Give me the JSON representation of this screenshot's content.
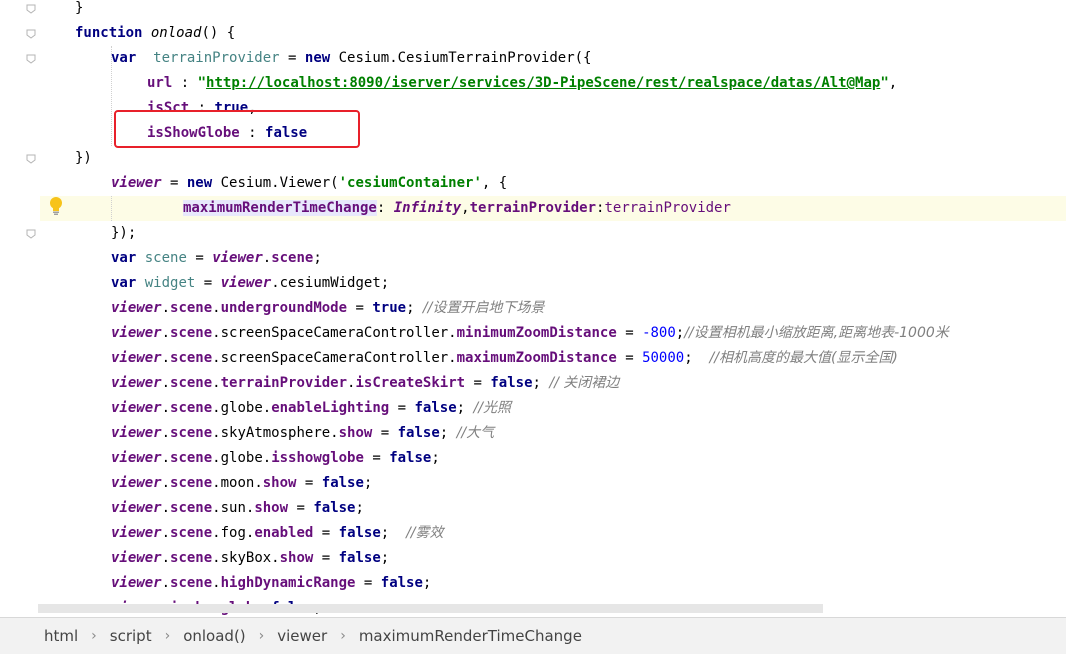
{
  "editor": {
    "lines": [
      {
        "tokens": [
          {
            "t": "}",
            "c": "plain"
          }
        ]
      },
      {
        "tokens": [
          {
            "t": "function",
            "c": "kw"
          },
          {
            "t": " ",
            "c": "plain"
          },
          {
            "t": "onload",
            "c": "fn"
          },
          {
            "t": "() {",
            "c": "plain"
          }
        ]
      },
      {
        "tokens": [
          {
            "t": "var",
            "c": "kw"
          },
          {
            "t": "  ",
            "c": "plain"
          },
          {
            "t": "terrainProvider",
            "c": "lv"
          },
          {
            "t": " = ",
            "c": "plain"
          },
          {
            "t": "new",
            "c": "kw"
          },
          {
            "t": " Cesium.CesiumTerrainProvider({",
            "c": "plain"
          }
        ]
      },
      {
        "tokens": [
          {
            "t": "url",
            "c": "pr"
          },
          {
            "t": " : ",
            "c": "plain"
          },
          {
            "t": "\"",
            "c": "str"
          },
          {
            "t": "http://localhost:8090/iserver/services/3D-PipeScene/rest/realspace/datas/Alt@Map",
            "c": "strlink"
          },
          {
            "t": "\"",
            "c": "str"
          },
          {
            "t": ",",
            "c": "plain"
          }
        ]
      },
      {
        "tokens": [
          {
            "t": "isSct",
            "c": "pr"
          },
          {
            "t": " : ",
            "c": "plain"
          },
          {
            "t": "true",
            "c": "kw"
          },
          {
            "t": ",",
            "c": "plain"
          }
        ]
      },
      {
        "tokens": [
          {
            "t": "isShowGlobe",
            "c": "pr"
          },
          {
            "t": " : ",
            "c": "plain"
          },
          {
            "t": "false",
            "c": "kw"
          }
        ]
      },
      {
        "tokens": [
          {
            "t": "})",
            "c": "plain"
          }
        ]
      },
      {
        "tokens": [
          {
            "t": "viewer",
            "c": "gv"
          },
          {
            "t": " = ",
            "c": "plain"
          },
          {
            "t": "new",
            "c": "kw"
          },
          {
            "t": " Cesium.Viewer(",
            "c": "plain"
          },
          {
            "t": "'cesiumContainer'",
            "c": "str"
          },
          {
            "t": ", {",
            "c": "plain"
          }
        ]
      },
      {
        "tokens": [
          {
            "t": "maximumRenderTimeChange",
            "c": "pr hl"
          },
          {
            "t": ": ",
            "c": "plain"
          },
          {
            "t": "Infinity",
            "c": "gv"
          },
          {
            "t": ",",
            "c": "plain"
          },
          {
            "t": "terrainProvider",
            "c": "pr"
          },
          {
            "t": ":",
            "c": "plain"
          },
          {
            "t": "terrainProvider",
            "c": "pr2"
          }
        ]
      },
      {
        "tokens": [
          {
            "t": "});",
            "c": "plain"
          }
        ]
      },
      {
        "tokens": [
          {
            "t": "var",
            "c": "kw"
          },
          {
            "t": " ",
            "c": "plain"
          },
          {
            "t": "scene",
            "c": "lv"
          },
          {
            "t": " = ",
            "c": "plain"
          },
          {
            "t": "viewer",
            "c": "gv"
          },
          {
            "t": ".",
            "c": "plain"
          },
          {
            "t": "scene",
            "c": "pr"
          },
          {
            "t": ";",
            "c": "plain"
          }
        ]
      },
      {
        "tokens": [
          {
            "t": "var",
            "c": "kw"
          },
          {
            "t": " ",
            "c": "plain"
          },
          {
            "t": "widget",
            "c": "lv"
          },
          {
            "t": " = ",
            "c": "plain"
          },
          {
            "t": "viewer",
            "c": "gv"
          },
          {
            "t": ".cesiumWidget;",
            "c": "plain"
          }
        ]
      },
      {
        "tokens": [
          {
            "t": "viewer",
            "c": "gv"
          },
          {
            "t": ".",
            "c": "plain"
          },
          {
            "t": "scene",
            "c": "pr"
          },
          {
            "t": ".",
            "c": "plain"
          },
          {
            "t": "undergroundMode",
            "c": "pr"
          },
          {
            "t": " = ",
            "c": "plain"
          },
          {
            "t": "true",
            "c": "kw"
          },
          {
            "t": "; ",
            "c": "plain"
          },
          {
            "t": "//设置开启地下场景",
            "c": "cm"
          }
        ]
      },
      {
        "tokens": [
          {
            "t": "viewer",
            "c": "gv"
          },
          {
            "t": ".",
            "c": "plain"
          },
          {
            "t": "scene",
            "c": "pr"
          },
          {
            "t": ".screenSpaceCameraController.",
            "c": "plain"
          },
          {
            "t": "minimumZoomDistance",
            "c": "pr"
          },
          {
            "t": " = ",
            "c": "plain"
          },
          {
            "t": "-800",
            "c": "num"
          },
          {
            "t": ";",
            "c": "plain"
          },
          {
            "t": "//设置相机最小缩放距离,距离地表-1000米",
            "c": "cm"
          }
        ]
      },
      {
        "tokens": [
          {
            "t": "viewer",
            "c": "gv"
          },
          {
            "t": ".",
            "c": "plain"
          },
          {
            "t": "scene",
            "c": "pr"
          },
          {
            "t": ".screenSpaceCameraController.",
            "c": "plain"
          },
          {
            "t": "maximumZoomDistance",
            "c": "pr"
          },
          {
            "t": " = ",
            "c": "plain"
          },
          {
            "t": "50000",
            "c": "num"
          },
          {
            "t": ";  ",
            "c": "plain"
          },
          {
            "t": "//相机高度的最大值(显示全国)",
            "c": "cm"
          }
        ]
      },
      {
        "tokens": [
          {
            "t": "viewer",
            "c": "gv"
          },
          {
            "t": ".",
            "c": "plain"
          },
          {
            "t": "scene",
            "c": "pr"
          },
          {
            "t": ".",
            "c": "plain"
          },
          {
            "t": "terrainProvider",
            "c": "pr"
          },
          {
            "t": ".",
            "c": "plain"
          },
          {
            "t": "isCreateSkirt",
            "c": "pr"
          },
          {
            "t": " = ",
            "c": "plain"
          },
          {
            "t": "false",
            "c": "kw"
          },
          {
            "t": "; ",
            "c": "plain"
          },
          {
            "t": "// 关闭裙边",
            "c": "cm"
          }
        ]
      },
      {
        "tokens": [
          {
            "t": "viewer",
            "c": "gv"
          },
          {
            "t": ".",
            "c": "plain"
          },
          {
            "t": "scene",
            "c": "pr"
          },
          {
            "t": ".globe.",
            "c": "plain"
          },
          {
            "t": "enableLighting",
            "c": "pr"
          },
          {
            "t": " = ",
            "c": "plain"
          },
          {
            "t": "false",
            "c": "kw"
          },
          {
            "t": "; ",
            "c": "plain"
          },
          {
            "t": "//光照",
            "c": "cm"
          }
        ]
      },
      {
        "tokens": [
          {
            "t": "viewer",
            "c": "gv"
          },
          {
            "t": ".",
            "c": "plain"
          },
          {
            "t": "scene",
            "c": "pr"
          },
          {
            "t": ".skyAtmosphere.",
            "c": "plain"
          },
          {
            "t": "show",
            "c": "pr"
          },
          {
            "t": " = ",
            "c": "plain"
          },
          {
            "t": "false",
            "c": "kw"
          },
          {
            "t": "; ",
            "c": "plain"
          },
          {
            "t": "//大气",
            "c": "cm"
          }
        ]
      },
      {
        "tokens": [
          {
            "t": "viewer",
            "c": "gv"
          },
          {
            "t": ".",
            "c": "plain"
          },
          {
            "t": "scene",
            "c": "pr"
          },
          {
            "t": ".globe.",
            "c": "plain"
          },
          {
            "t": "isshowglobe",
            "c": "pr"
          },
          {
            "t": " = ",
            "c": "plain"
          },
          {
            "t": "false",
            "c": "kw"
          },
          {
            "t": ";",
            "c": "plain"
          }
        ]
      },
      {
        "tokens": [
          {
            "t": "viewer",
            "c": "gv"
          },
          {
            "t": ".",
            "c": "plain"
          },
          {
            "t": "scene",
            "c": "pr"
          },
          {
            "t": ".moon.",
            "c": "plain"
          },
          {
            "t": "show",
            "c": "pr"
          },
          {
            "t": " = ",
            "c": "plain"
          },
          {
            "t": "false",
            "c": "kw"
          },
          {
            "t": ";",
            "c": "plain"
          }
        ]
      },
      {
        "tokens": [
          {
            "t": "viewer",
            "c": "gv"
          },
          {
            "t": ".",
            "c": "plain"
          },
          {
            "t": "scene",
            "c": "pr"
          },
          {
            "t": ".sun.",
            "c": "plain"
          },
          {
            "t": "show",
            "c": "pr"
          },
          {
            "t": " = ",
            "c": "plain"
          },
          {
            "t": "false",
            "c": "kw"
          },
          {
            "t": ";",
            "c": "plain"
          }
        ]
      },
      {
        "tokens": [
          {
            "t": "viewer",
            "c": "gv"
          },
          {
            "t": ".",
            "c": "plain"
          },
          {
            "t": "scene",
            "c": "pr"
          },
          {
            "t": ".fog.",
            "c": "plain"
          },
          {
            "t": "enabled",
            "c": "pr"
          },
          {
            "t": " = ",
            "c": "plain"
          },
          {
            "t": "false",
            "c": "kw"
          },
          {
            "t": ";  ",
            "c": "plain"
          },
          {
            "t": "//雾效",
            "c": "cm"
          }
        ]
      },
      {
        "tokens": [
          {
            "t": "viewer",
            "c": "gv"
          },
          {
            "t": ".",
            "c": "plain"
          },
          {
            "t": "scene",
            "c": "pr"
          },
          {
            "t": ".skyBox.",
            "c": "plain"
          },
          {
            "t": "show",
            "c": "pr"
          },
          {
            "t": " = ",
            "c": "plain"
          },
          {
            "t": "false",
            "c": "kw"
          },
          {
            "t": ";",
            "c": "plain"
          }
        ]
      },
      {
        "tokens": [
          {
            "t": "viewer",
            "c": "gv"
          },
          {
            "t": ".",
            "c": "plain"
          },
          {
            "t": "scene",
            "c": "pr"
          },
          {
            "t": ".",
            "c": "plain"
          },
          {
            "t": "highDynamicRange",
            "c": "pr"
          },
          {
            "t": " = ",
            "c": "plain"
          },
          {
            "t": "false",
            "c": "kw"
          },
          {
            "t": ";",
            "c": "plain"
          }
        ]
      },
      {
        "tokens": [
          {
            "t": "viewer",
            "c": "gv"
          },
          {
            "t": ".",
            "c": "plain"
          },
          {
            "t": "isshowglobe",
            "c": "pr"
          },
          {
            "t": "=",
            "c": "plain"
          },
          {
            "t": "false",
            "c": "kw"
          },
          {
            "t": ";",
            "c": "plain"
          }
        ]
      }
    ]
  },
  "breadcrumb": {
    "items": [
      "html",
      "script",
      "onload()",
      "viewer",
      "maximumRenderTimeChange"
    ],
    "separator": "›"
  },
  "icons": {
    "fold_marker": "fold-marker-icon",
    "intention": "lightbulb-icon"
  },
  "colors": {
    "keyword": "#000080",
    "string": "#008000",
    "property": "#660e7a",
    "number": "#0000ff",
    "comment": "#808080",
    "annotation_box": "#e8202a",
    "active_line": "#fdfce6"
  }
}
